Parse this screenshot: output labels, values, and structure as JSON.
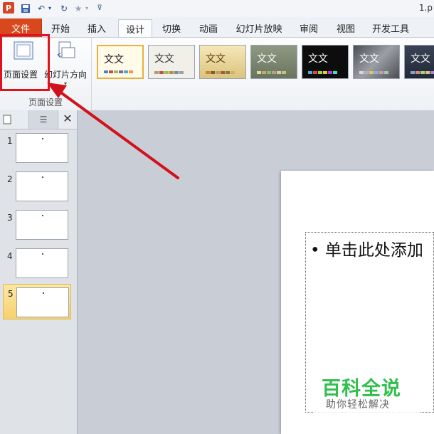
{
  "window": {
    "title": "1.p"
  },
  "tabs": [
    {
      "label": "文件"
    },
    {
      "label": "开始"
    },
    {
      "label": "插入"
    },
    {
      "label": "设计"
    },
    {
      "label": "切换"
    },
    {
      "label": "动画"
    },
    {
      "label": "幻灯片放映"
    },
    {
      "label": "审阅"
    },
    {
      "label": "视图"
    },
    {
      "label": "开发工具"
    }
  ],
  "ribbon": {
    "page_setup_label": "页面设置",
    "orientation_label": "幻灯片方向",
    "group_label": "页面设置",
    "theme_sample_text": "文文"
  },
  "themes": [
    {
      "name": "theme-office",
      "bg": "#ffffff",
      "fg": "#222222"
    },
    {
      "name": "theme-light",
      "bg": "#f0efe8",
      "fg": "#333333"
    },
    {
      "name": "theme-sand",
      "bg": "#e9d9a6",
      "fg": "#5a3a10"
    },
    {
      "name": "theme-olive",
      "bg": "#7d8a72",
      "fg": "#ffffff"
    },
    {
      "name": "theme-black",
      "bg": "#111111",
      "fg": "#ffffff"
    },
    {
      "name": "theme-gray",
      "bg": "#6a6d72",
      "fg": "#ffffff"
    },
    {
      "name": "theme-slate",
      "bg": "#2c3444",
      "fg": "#ffffff"
    }
  ],
  "slides": [
    {
      "number": "1"
    },
    {
      "number": "2"
    },
    {
      "number": "3"
    },
    {
      "number": "4"
    },
    {
      "number": "5"
    }
  ],
  "slide_content": {
    "placeholder_text": "• 单击此处添加"
  },
  "watermark": {
    "title": "百科全说",
    "subtitle": "助你轻松解决"
  },
  "colors": {
    "file_tab": "#d8481c",
    "highlight": "#e0121e",
    "selected_slide": "#f7d26b"
  }
}
